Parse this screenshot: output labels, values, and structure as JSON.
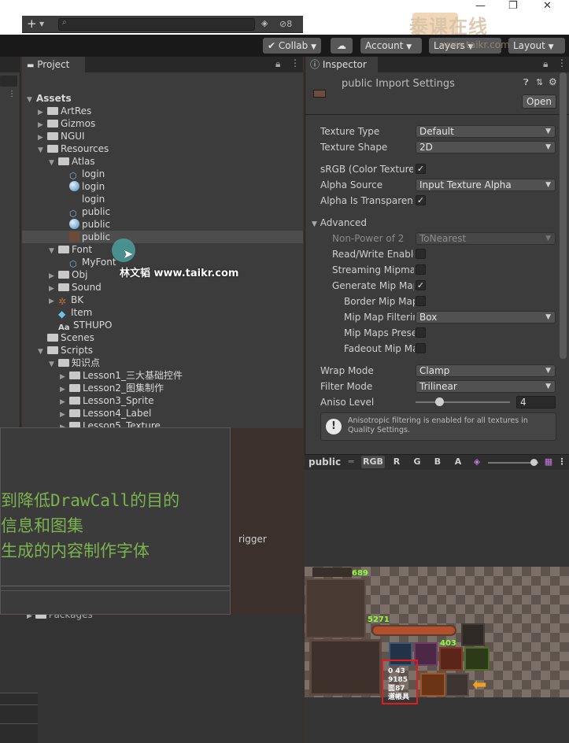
{
  "toolbar": {
    "collab": "Collab",
    "account": "Account",
    "layers": "Layers",
    "layout": "Layout"
  },
  "watermark": {
    "brand": "泰课在线",
    "url": "www.taikr.com"
  },
  "project": {
    "tab": "Project",
    "hidden_count": "8",
    "tree": [
      {
        "label": "Assets",
        "type": "root"
      },
      {
        "label": "ArtRes",
        "type": "folder"
      },
      {
        "label": "Gizmos",
        "type": "folder"
      },
      {
        "label": "NGUI",
        "type": "folder"
      },
      {
        "label": "Resources",
        "type": "folder-open"
      },
      {
        "label": "Atlas",
        "type": "folder-open"
      },
      {
        "label": "login",
        "type": "prefab"
      },
      {
        "label": "login",
        "type": "material"
      },
      {
        "label": "login",
        "type": "texture"
      },
      {
        "label": "public",
        "type": "prefab"
      },
      {
        "label": "public",
        "type": "material"
      },
      {
        "label": "public",
        "type": "texture",
        "selected": true
      },
      {
        "label": "Font",
        "type": "folder-open"
      },
      {
        "label": "MyFont",
        "type": "font"
      },
      {
        "label": "Obj",
        "type": "folder"
      },
      {
        "label": "Sound",
        "type": "folder"
      },
      {
        "label": "BK",
        "type": "scene-folder"
      },
      {
        "label": "Item",
        "type": "cube"
      },
      {
        "label": "STHUPO",
        "type": "font-asset"
      },
      {
        "label": "Scenes",
        "type": "folder"
      },
      {
        "label": "Scripts",
        "type": "folder-open"
      },
      {
        "label": "知识点",
        "type": "folder-open"
      },
      {
        "label": "Lesson1_三大基础控件",
        "type": "folder"
      },
      {
        "label": "Lesson2_图集制作",
        "type": "folder"
      },
      {
        "label": "Lesson3_Sprite",
        "type": "folder"
      },
      {
        "label": "Lesson4_Label",
        "type": "folder"
      },
      {
        "label": "Lesson5_Texture",
        "type": "folder"
      }
    ],
    "packages": "Packages",
    "partial_trigger": "rigger"
  },
  "inspector": {
    "tab": "Inspector",
    "title": "public Import Settings",
    "open_button": "Open",
    "fields": {
      "texture_type": {
        "label": "Texture Type",
        "value": "Default"
      },
      "texture_shape": {
        "label": "Texture Shape",
        "value": "2D"
      },
      "srgb": {
        "label": "sRGB (Color Texture)",
        "checked": true
      },
      "alpha_source": {
        "label": "Alpha Source",
        "value": "Input Texture Alpha"
      },
      "alpha_transparency": {
        "label": "Alpha Is Transparenc",
        "checked": true
      },
      "advanced": "Advanced",
      "non_power": {
        "label": "Non-Power of 2",
        "value": "ToNearest"
      },
      "read_write": {
        "label": "Read/Write Enable",
        "checked": false
      },
      "streaming": {
        "label": "Streaming Mipmap",
        "checked": false
      },
      "gen_mip": {
        "label": "Generate Mip Map",
        "checked": true
      },
      "border_mip": {
        "label": "Border Mip Map",
        "checked": false
      },
      "mip_filter": {
        "label": "Mip Map Filterin",
        "value": "Box"
      },
      "mip_preserve": {
        "label": "Mip Maps Prese",
        "checked": false
      },
      "fadeout": {
        "label": "Fadeout Mip Ma",
        "checked": false
      },
      "wrap_mode": {
        "label": "Wrap Mode",
        "value": "Clamp"
      },
      "filter_mode": {
        "label": "Filter Mode",
        "value": "Trilinear"
      },
      "aniso": {
        "label": "Aniso Level",
        "value": "4",
        "slider_fraction": 0.25
      }
    },
    "info": "Anisotropic filtering is enabled for all textures in Quality Settings.",
    "preview": {
      "name": "public",
      "channels": [
        "RGB",
        "R",
        "G",
        "B",
        "A"
      ],
      "numbers": [
        "689",
        "5271",
        "403"
      ],
      "glyphs": [
        "0 43",
        "9185",
        "面87",
        "道帳具"
      ]
    }
  },
  "overlay": {
    "lines": [
      "到降低DrawCall的目的",
      "信息和图集",
      "生成的内容制作字体"
    ]
  },
  "cursor_label": "林文韬 www.taikr.com"
}
